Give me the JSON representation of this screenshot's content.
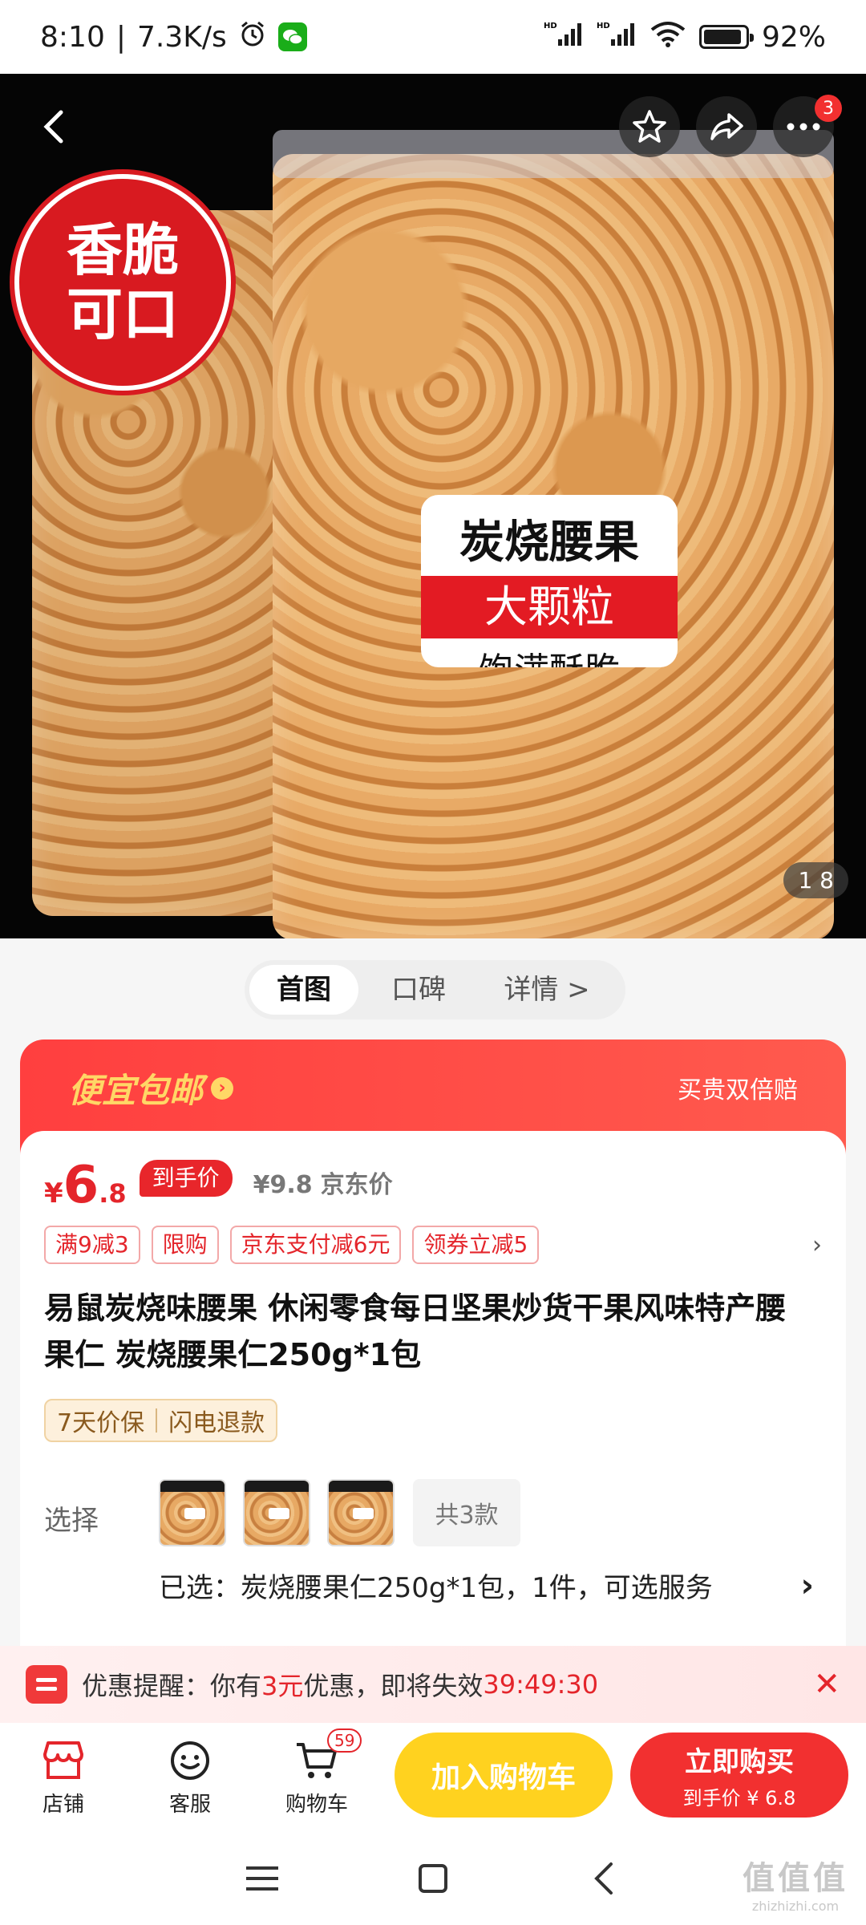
{
  "status": {
    "time": "8:10",
    "net_speed": "7.3K/s",
    "hd1": "HD",
    "hd2": "HD",
    "battery": "92%",
    "battery_level": 0.92
  },
  "hero": {
    "badge_line1": "香脆",
    "badge_line2": "可口",
    "label_line1": "炭烧腰果",
    "label_line2": "大颗粒",
    "label_line3": "饱满酥脆",
    "more_badge": "3",
    "pager": "1 8"
  },
  "tabs": [
    {
      "label": "首图"
    },
    {
      "label": "口碑"
    },
    {
      "label": "详情 >"
    }
  ],
  "promo": {
    "title": "便宜包邮",
    "arrow": "›",
    "right": "买贵双倍赔"
  },
  "price": {
    "symbol": "¥",
    "integer": "6",
    "decimal": ".8",
    "tag": "到手价",
    "original": "¥9.8",
    "original_label": "京东价"
  },
  "coupons": [
    "满9减3",
    "限购",
    "京东支付减6元",
    "领券立减5"
  ],
  "coupons_chevron": "›",
  "product_title": "易鼠炭烧味腰果 休闲零食每日坚果炒货干果风味特产腰果仁  炭烧腰果仁250g*1包",
  "guarantee": [
    "7天价保",
    "闪电退款"
  ],
  "choose": {
    "label": "选择",
    "count": "共3款",
    "selected": "已选：炭烧腰果仁250g*1包，1件，可选服务",
    "chevron": "›"
  },
  "reminder": {
    "prefix": "优惠提醒：你有",
    "amount": "3元",
    "middle": "优惠，即将失效",
    "countdown": "39:49:30",
    "close": "✕"
  },
  "bottombar": {
    "store": "店铺",
    "service": "客服",
    "cart": "购物车",
    "cart_count": "59",
    "add_cart": "加入购物车",
    "buy_now": "立即购买",
    "buy_sub": "到手价 ¥ 6.8"
  },
  "watermark": {
    "line1": "值值值",
    "line2": "zhizhizhi.com"
  },
  "colors": {
    "accent_red": "#e4252b",
    "promo_yellow": "#ffd766",
    "cart_yellow": "#ffd21f",
    "buy_red": "#f23030"
  },
  "icons": [
    "back-icon",
    "star-icon",
    "share-icon",
    "more-icon",
    "store-icon",
    "service-icon",
    "cart-icon",
    "menu-icon",
    "home-icon",
    "nav-back-icon",
    "alarm-icon",
    "wechat-icon",
    "signal-icon",
    "wifi-icon",
    "battery-icon"
  ]
}
